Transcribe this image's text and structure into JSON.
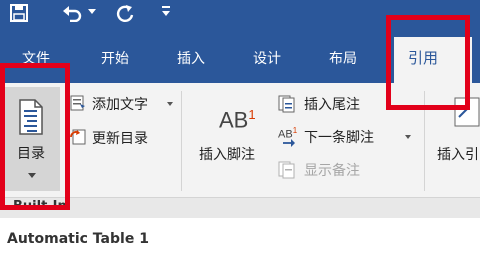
{
  "colors": {
    "brand_blue": "#2b579a",
    "highlight_red": "#e2001a",
    "ribbon_bg": "#f3f3f3"
  },
  "quick_access": {
    "icons": [
      "save-icon",
      "undo-icon",
      "redo-icon",
      "customize-icon"
    ]
  },
  "tabs": [
    {
      "label": "文件"
    },
    {
      "label": "开始"
    },
    {
      "label": "插入"
    },
    {
      "label": "设计"
    },
    {
      "label": "布局"
    },
    {
      "label": "引用",
      "active": true
    }
  ],
  "ribbon": {
    "toc": {
      "label": "目录"
    },
    "add_text": {
      "label": "添加文字"
    },
    "update_toc": {
      "label": "更新目录"
    },
    "insert_footnote": {
      "label": "插入脚注",
      "icon_text": "AB",
      "superscript": "1"
    },
    "insert_endnote": {
      "label": "插入尾注"
    },
    "next_footnote": {
      "label": "下一条脚注"
    },
    "show_notes": {
      "label": "显示备注"
    },
    "insert_citation": {
      "label": "插入引"
    }
  },
  "gallery": {
    "section": "Built-In",
    "item": "Automatic Table 1"
  }
}
